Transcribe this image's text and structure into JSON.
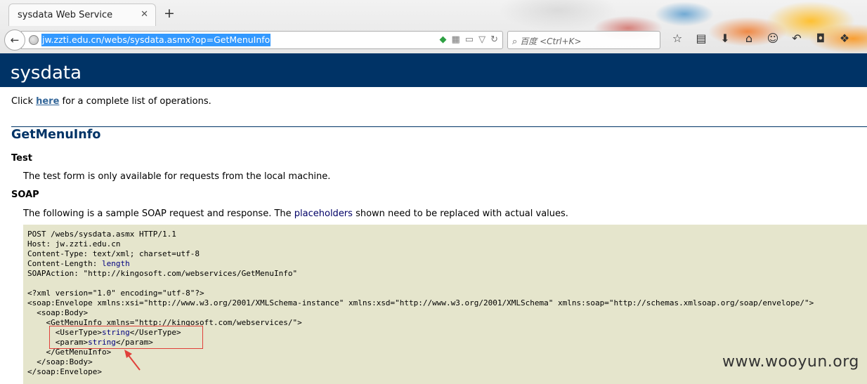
{
  "browser": {
    "tab_title": "sysdata Web Service",
    "tab_close": "✕",
    "new_tab": "+",
    "url": "jw.zzti.edu.cn/webs/sysdata.asmx?op=GetMenuInfo",
    "search_placeholder": "百度 <Ctrl+K>",
    "icons": [
      "back-icon",
      "globe-icon",
      "shield-icon",
      "qr-icon",
      "reader-icon",
      "dropdown-icon",
      "refresh-icon",
      "search-icon",
      "bookmark-star-icon",
      "library-icon",
      "download-icon",
      "home-icon",
      "chat-icon",
      "undo-icon",
      "message-icon",
      "addon-icon"
    ]
  },
  "page": {
    "banner_title": "sysdata",
    "click_prefix": "Click ",
    "click_link": "here",
    "click_suffix": " for a complete list of operations.",
    "operation_title": "GetMenuInfo",
    "test_heading": "Test",
    "test_text": "The test form is only available for requests from the local machine.",
    "soap_heading": "SOAP",
    "soap_text_prefix": "The following is a sample SOAP request and response. The ",
    "soap_text_link": "placeholders",
    "soap_text_suffix": " shown need to be replaced with actual values.",
    "code": {
      "l1": "POST /webs/sysdata.asmx HTTP/1.1",
      "l2": "Host: jw.zzti.edu.cn",
      "l3": "Content-Type: text/xml; charset=utf-8",
      "l4_key": "Content-Length: ",
      "l4_val": "length",
      "l5": "SOAPAction: \"http://kingosoft.com/webservices/GetMenuInfo\"",
      "l6": "<?xml version=\"1.0\" encoding=\"utf-8\"?>",
      "l7": "<soap:Envelope xmlns:xsi=\"http://www.w3.org/2001/XMLSchema-instance\" xmlns:xsd=\"http://www.w3.org/2001/XMLSchema\" xmlns:soap=\"http://schemas.xmlsoap.org/soap/envelope/\">",
      "l8": "  <soap:Body>",
      "l9": "    <GetMenuInfo xmlns=\"http://kingosoft.com/webservices/\">",
      "l10_open": "      <UserType>",
      "l10_val": "string",
      "l10_close": "</UserType>",
      "l11_open": "      <param>",
      "l11_val": "string",
      "l11_close": "</param>",
      "l12": "    </GetMenuInfo>",
      "l13": "  </soap:Body>",
      "l14": "</soap:Envelope>"
    },
    "watermark": "www.wooyun.org"
  },
  "colors": {
    "banner": "#003366",
    "code_bg": "#e5e5cc",
    "annotation": "#e0403a",
    "url_selection": "#3399ff"
  }
}
